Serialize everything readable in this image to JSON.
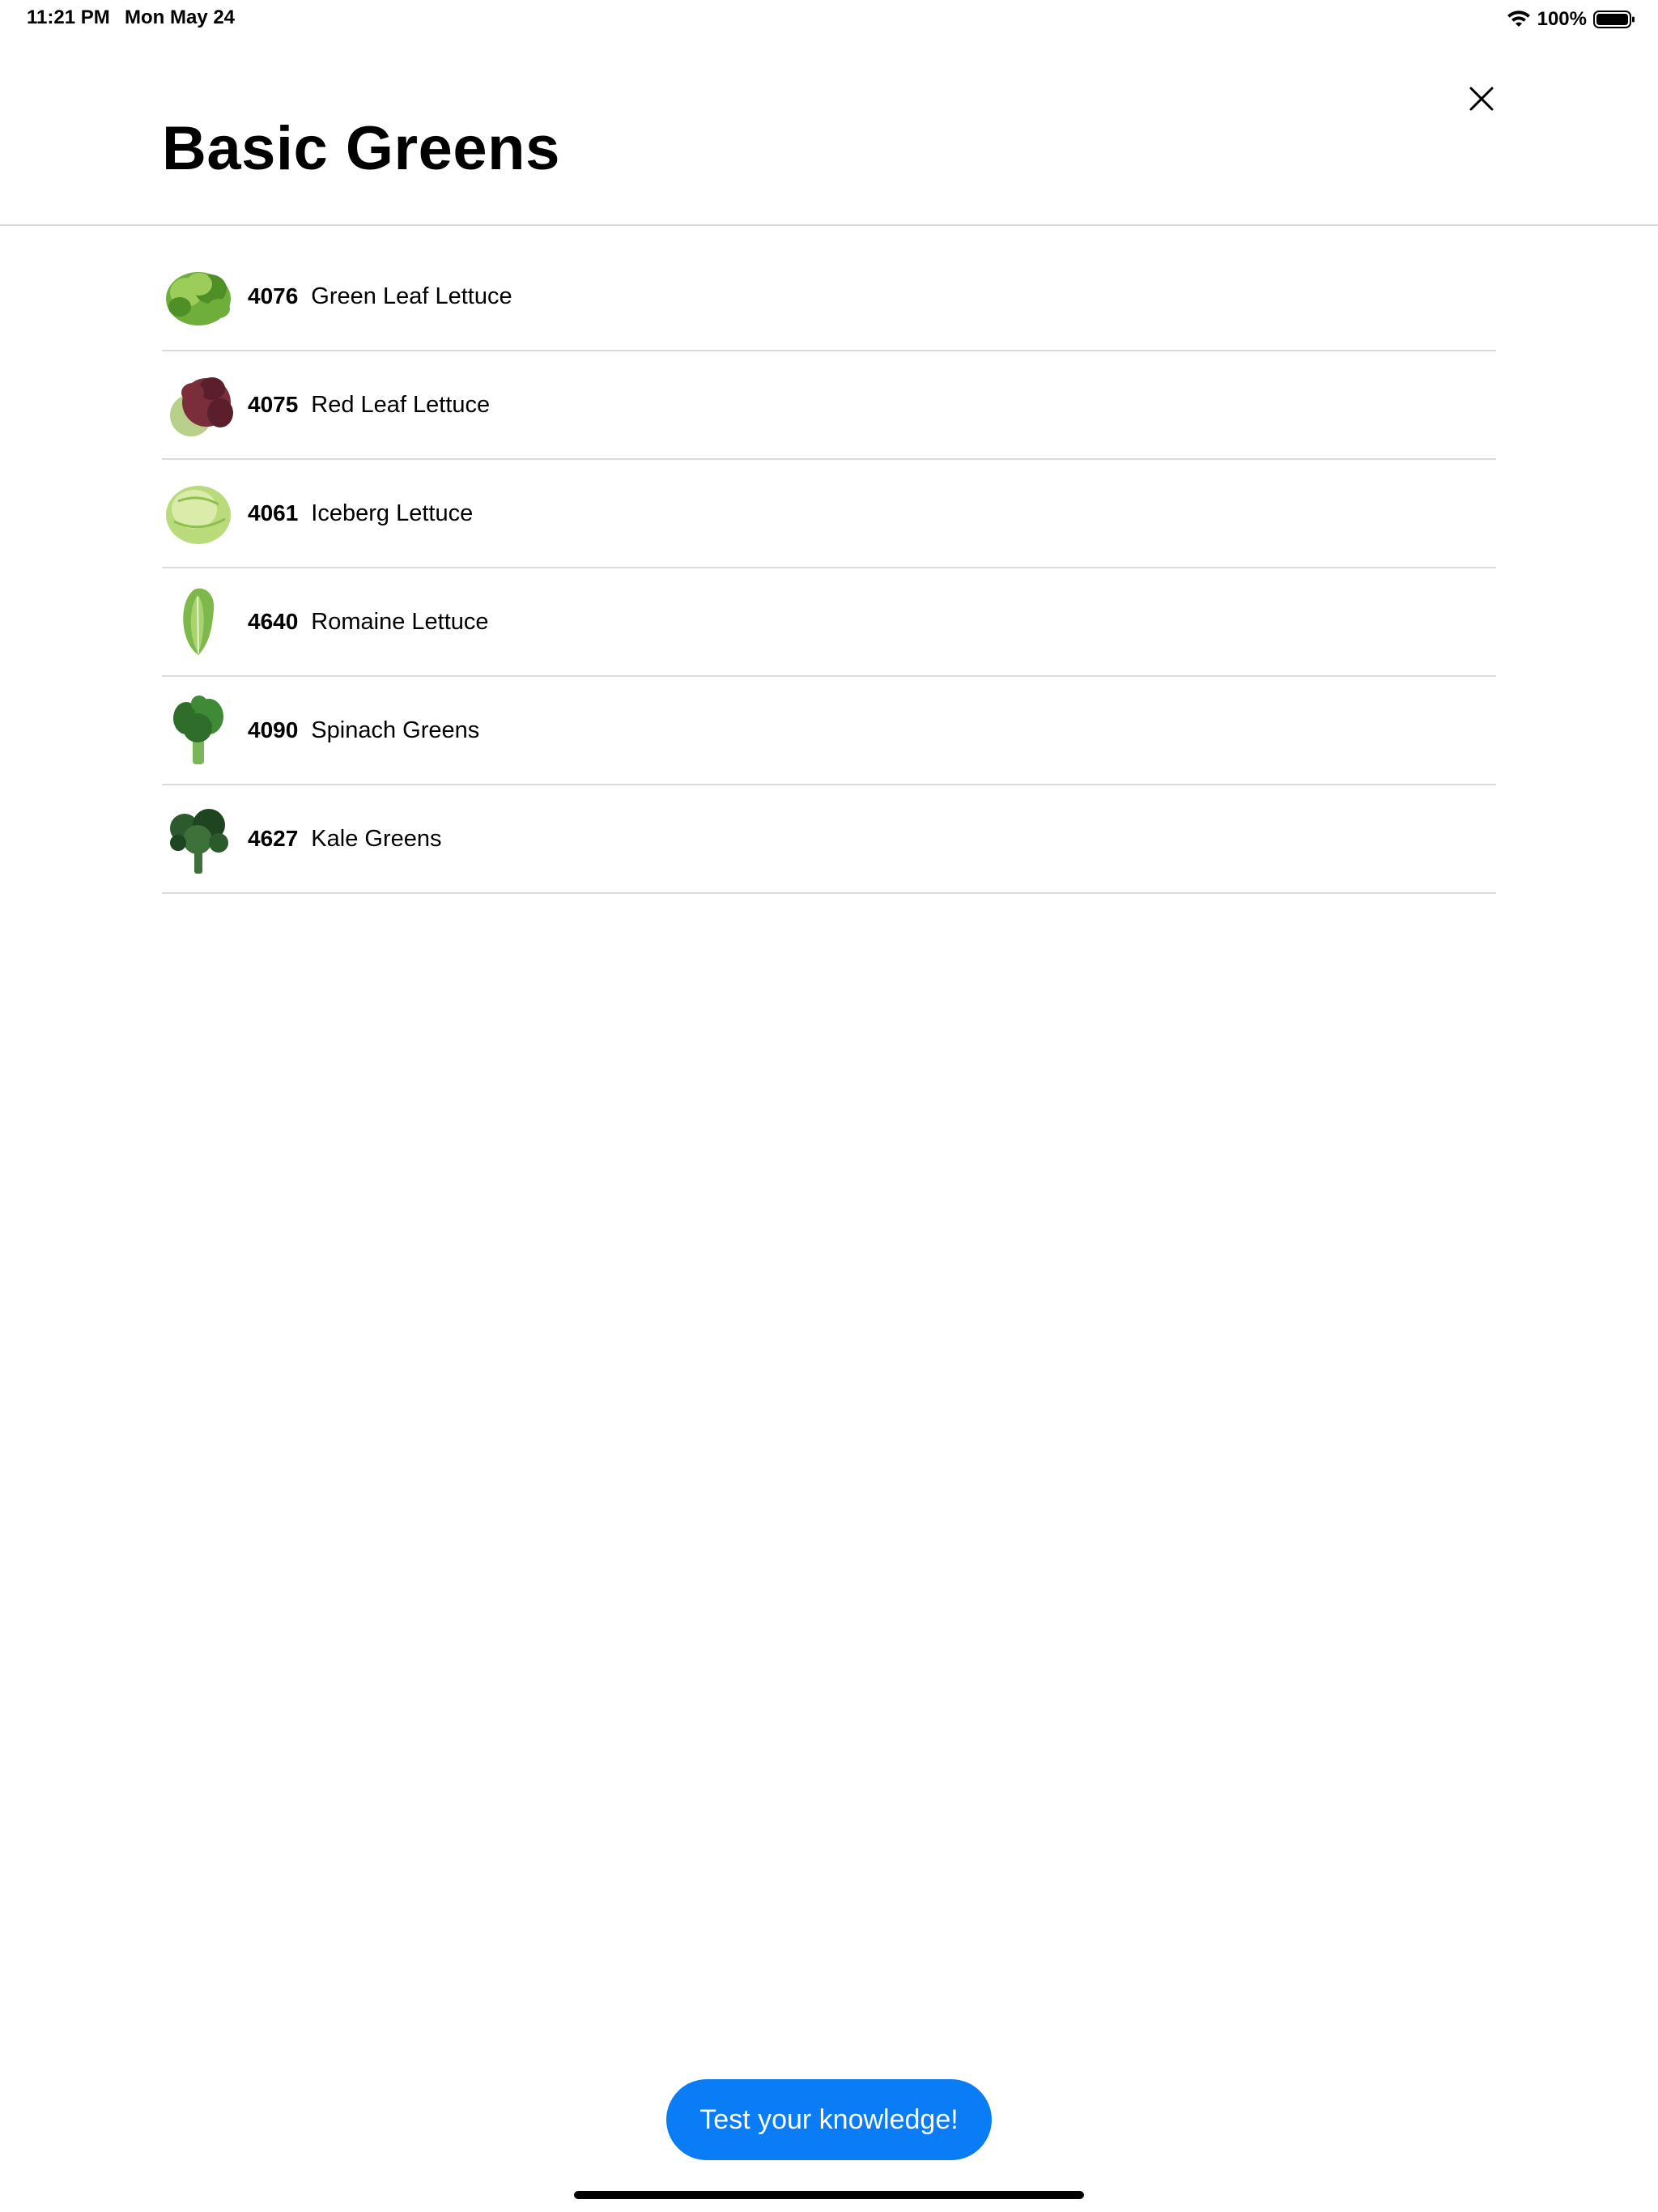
{
  "status_bar": {
    "time": "11:21 PM",
    "date": "Mon May 24",
    "battery": "100%",
    "wifi_icon": "wifi-icon",
    "battery_icon": "battery-full-icon"
  },
  "header": {
    "title": "Basic Greens",
    "close_icon": "close-icon"
  },
  "items": [
    {
      "plu": "4076",
      "name": "Green Leaf Lettuce",
      "image": "green-leaf-lettuce-image",
      "colors": [
        "#6fae3a",
        "#4e8f26",
        "#9ccd5a"
      ]
    },
    {
      "plu": "4075",
      "name": "Red Leaf Lettuce",
      "image": "red-leaf-lettuce-image",
      "colors": [
        "#7a2e3a",
        "#5b1f2c",
        "#b8d08a"
      ]
    },
    {
      "plu": "4061",
      "name": "Iceberg Lettuce",
      "image": "iceberg-lettuce-image",
      "colors": [
        "#b9db7c",
        "#d9ecaa",
        "#8fbf4f"
      ]
    },
    {
      "plu": "4640",
      "name": "Romaine Lettuce",
      "image": "romaine-lettuce-image",
      "colors": [
        "#7fb84a",
        "#a9d36f",
        "#5e9a31"
      ]
    },
    {
      "plu": "4090",
      "name": "Spinach Greens",
      "image": "spinach-image",
      "colors": [
        "#2f6d2a",
        "#3f8a34",
        "#79b65a"
      ]
    },
    {
      "plu": "4627",
      "name": "Kale Greens",
      "image": "kale-image",
      "colors": [
        "#2c5a2c",
        "#3e7039",
        "#1f4420"
      ]
    }
  ],
  "cta": {
    "label": "Test your knowledge!",
    "color": "#0a7cf5"
  }
}
